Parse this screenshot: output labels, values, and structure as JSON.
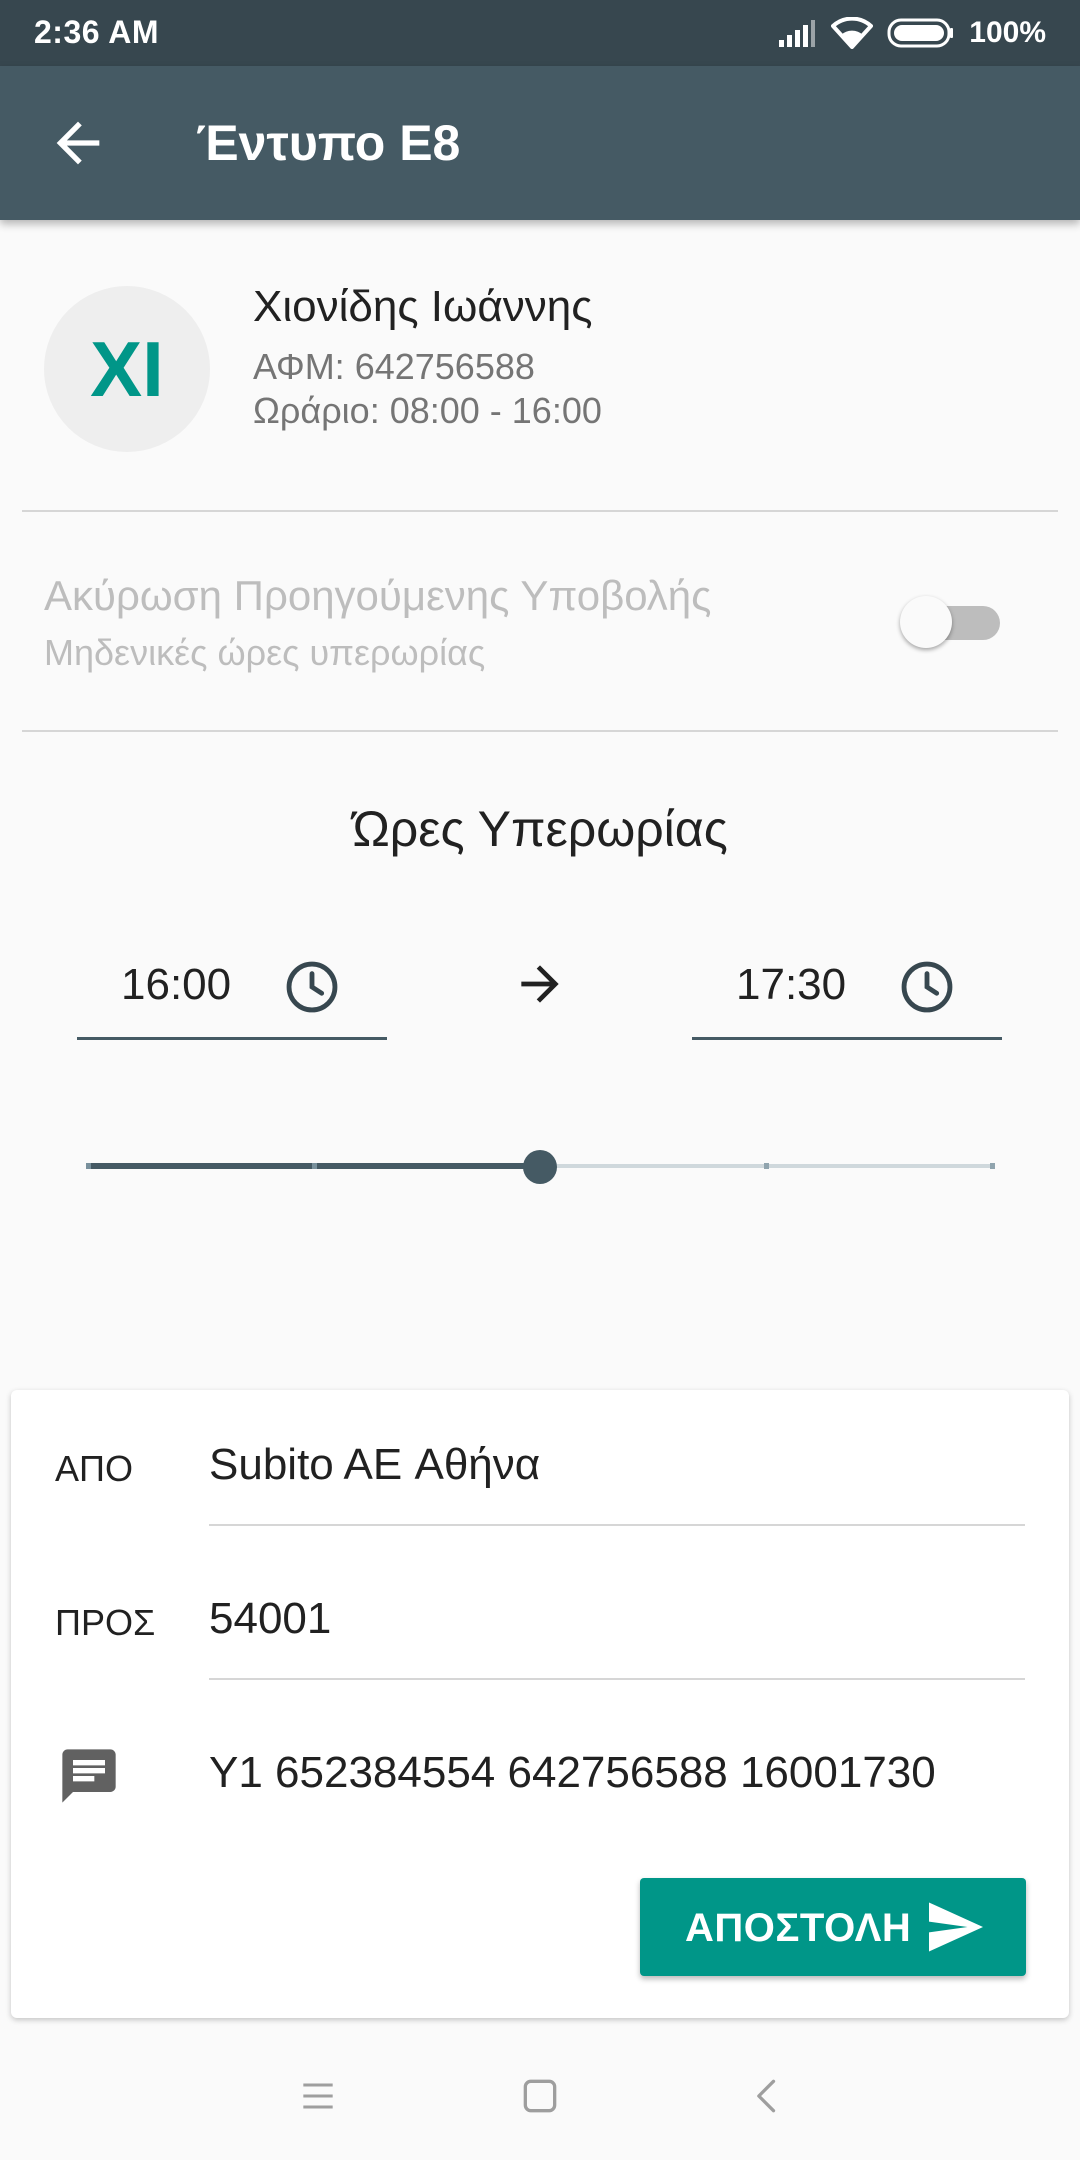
{
  "status_bar": {
    "time": "2:36 AM",
    "battery_percent": "100%",
    "icons": [
      "signal-icon",
      "wifi-icon",
      "battery-icon"
    ]
  },
  "app_bar": {
    "title": "Έντυπο Ε8",
    "back_icon": "arrow-back-icon"
  },
  "employee": {
    "initials": "ΧΙ",
    "name": "Χιονίδης Ιωάννης",
    "afm": "ΑΦΜ: 642756588",
    "schedule": "Ωράριο: 08:00 - 16:00"
  },
  "cancel_previous": {
    "title": "Ακύρωση Προηγούμενης Υποβολής",
    "subtitle": "Μηδενικές ώρες υπερωρίας",
    "enabled": false
  },
  "overtime": {
    "title": "Ώρες Υπερωρίας",
    "from": "16:00",
    "to": "17:30",
    "slider": {
      "steps": 5,
      "selected_index": 2
    }
  },
  "sms": {
    "from_label": "ΑΠΟ",
    "from_value": "Subito AE Αθήνα",
    "to_label": "ΠΡΟΣ",
    "to_value": "54001",
    "message": "Y1 652384554 642756588 16001730",
    "send_label": "ΑΠΟΣΤΟΛΗ"
  },
  "colors": {
    "status_bar": "#37474F",
    "app_bar": "#455A64",
    "accent": "#009688"
  },
  "nav_bar": [
    "menu-icon",
    "home-icon",
    "back-icon"
  ]
}
